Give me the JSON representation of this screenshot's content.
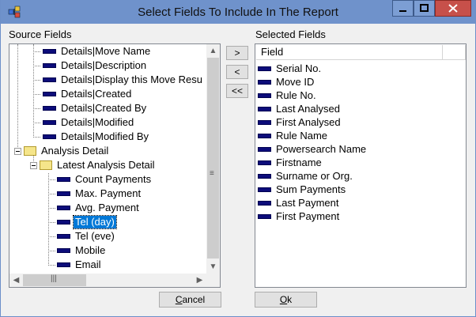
{
  "window": {
    "title": "Select Fields To Include In The Report"
  },
  "source": {
    "label": "Source Fields",
    "items": [
      "Details|Move Name",
      "Details|Description",
      "Details|Display this Move Resu",
      "Details|Created",
      "Details|Created By",
      "Details|Modified",
      "Details|Modified By"
    ],
    "folders": {
      "analysis_detail": "Analysis Detail",
      "latest_analysis_detail": "Latest Analysis Detail"
    },
    "children": [
      "Count Payments",
      "Max. Payment",
      "Avg. Payment",
      "Tel (day)",
      "Tel (eve)",
      "Mobile",
      "Email"
    ],
    "selected": "Tel (day)"
  },
  "buttons": {
    "add": ">",
    "remove": "<",
    "remove_all": "<<",
    "cancel_pre": "",
    "cancel_key": "C",
    "cancel_rest": "ancel",
    "ok_key": "O",
    "ok_rest": "k"
  },
  "selected_fields": {
    "label": "Selected Fields",
    "header": "Field",
    "items": [
      "Serial No.",
      "Move ID",
      "Rule No.",
      "Last Analysed",
      "First Analysed",
      "Rule Name",
      "Powersearch Name",
      "Firstname",
      "Surname or Org.",
      "Sum Payments",
      "Last Payment",
      "First Payment"
    ]
  },
  "colors": {
    "titlebar": "#6f92cb",
    "selection": "#0078d7",
    "close": "#c7504a"
  }
}
